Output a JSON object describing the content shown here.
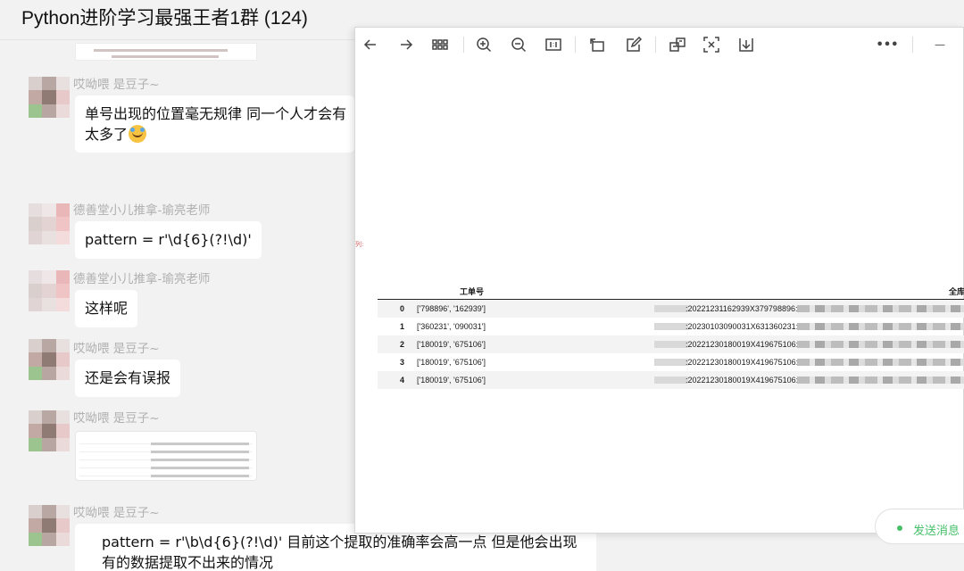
{
  "chat": {
    "title": "Python进阶学习最强王者1群 (124)"
  },
  "messages": [
    {
      "sender": "哎呦喂   是豆子~",
      "line1": "单号出现的位置毫无规律  同一个人才会有",
      "line2": "太多了"
    },
    {
      "sender": "德善堂小儿推拿-瑜亮老师",
      "text": "pattern = r'\\d{6}(?!\\d)'"
    },
    {
      "sender": "德善堂小儿推拿-瑜亮老师",
      "text": "这样呢"
    },
    {
      "sender": "哎呦喂   是豆子~",
      "text": "还是会有误报"
    },
    {
      "sender": "哎呦喂   是豆子~"
    },
    {
      "sender": "哎呦喂   是豆子~",
      "line1": "pattern = r'\\b\\d{6}(?!\\d)'  目前这个提取的准确率会高一点  但是他会出现",
      "line2": "有的数据提取不出来的情况"
    }
  ],
  "viewer": {
    "toolbar_icons": [
      "back-icon",
      "forward-icon",
      "grid-icon",
      "zoom-in-icon",
      "zoom-out-icon",
      "actual-size-icon",
      "rotate-icon",
      "edit-icon",
      "ocr-icon",
      "translate-icon",
      "download-icon",
      "more-icon",
      "minimize-icon"
    ],
    "more_label": "•••",
    "minimize_label": "—",
    "side_mark": "列:",
    "table": {
      "headers": [
        "工单号",
        "全库"
      ],
      "rows": [
        {
          "index": "0",
          "value": "['798896', '162939']",
          "num": ":20221231162939X379798896:"
        },
        {
          "index": "1",
          "value": "['360231', '090031']",
          "num": ":20230103090031X631360231:"
        },
        {
          "index": "2",
          "value": "['180019', '675106']",
          "num": ":20221230180019X419675106:"
        },
        {
          "index": "3",
          "value": "['180019', '675106']",
          "num": ":20221230180019X419675106:"
        },
        {
          "index": "4",
          "value": "['180019', '675106']",
          "num": ":20221230180019X419675106:"
        }
      ]
    }
  },
  "pill": {
    "label": "发送消息"
  },
  "colors": {
    "accent_green": "#45c06a",
    "bubble": "#ffffff",
    "background": "#f2f2f2"
  }
}
